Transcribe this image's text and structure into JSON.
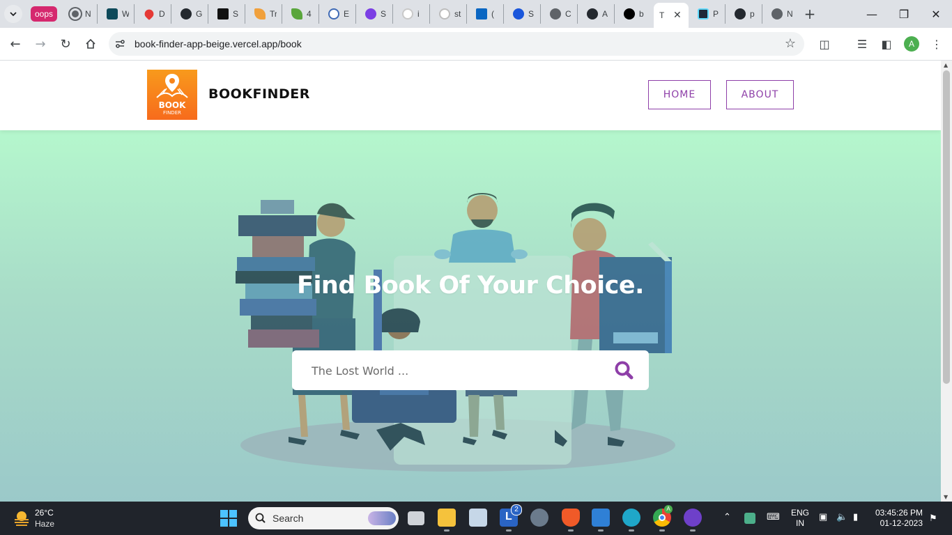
{
  "browser": {
    "tabs": [
      {
        "label": "oops",
        "icon": "oops-extension-icon"
      },
      {
        "label": "N",
        "icon": "chrome-page-icon"
      },
      {
        "label": "W",
        "icon": "m-app-icon"
      },
      {
        "label": "D",
        "icon": "heart-icon"
      },
      {
        "label": "G",
        "icon": "github-icon"
      },
      {
        "label": "S",
        "icon": "hacker-news-icon"
      },
      {
        "label": "Tr",
        "icon": "leaf-icon"
      },
      {
        "label": "4",
        "icon": "leaf-icon"
      },
      {
        "label": "E",
        "icon": "globe-icon"
      },
      {
        "label": "S",
        "icon": "purple-play-icon"
      },
      {
        "label": "i",
        "icon": "google-icon"
      },
      {
        "label": "st",
        "icon": "google-icon"
      },
      {
        "label": "(",
        "icon": "linkedin-icon"
      },
      {
        "label": "S",
        "icon": "blue-link-icon"
      },
      {
        "label": "C",
        "icon": "chrome-page-icon"
      },
      {
        "label": "A",
        "icon": "github-icon"
      },
      {
        "label": "b",
        "icon": "black-triangle-icon"
      },
      {
        "label": "T",
        "icon": "active"
      },
      {
        "label": "P",
        "icon": "react-icon"
      },
      {
        "label": "p",
        "icon": "github-icon"
      },
      {
        "label": "N",
        "icon": "chrome-page-icon"
      }
    ],
    "url": "book-finder-app-beige.vercel.app/book",
    "profile_initial": "A"
  },
  "site": {
    "logo_text": "BOOK FINDER",
    "brand": "BOOKFINDER",
    "nav": {
      "home": "HOME",
      "about": "ABOUT"
    },
    "accent_color": "#8e3fa8"
  },
  "hero": {
    "title": "Find Book Of Your Choice.",
    "search_placeholder": "The Lost World ..."
  },
  "taskbar": {
    "weather_temp": "26°C",
    "weather_desc": "Haze",
    "search_label": "Search",
    "lang_line1": "ENG",
    "lang_line2": "IN",
    "time": "03:45:26 PM",
    "date": "01-12-2023",
    "notification_badge": "2",
    "chrome_badge": "A"
  }
}
